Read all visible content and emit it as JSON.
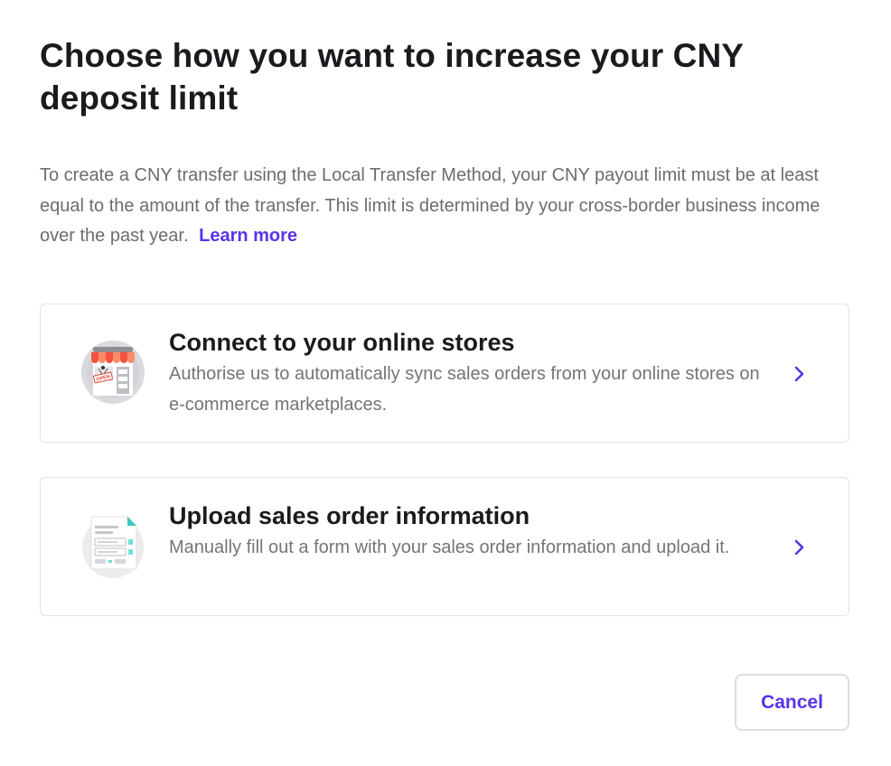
{
  "dialog": {
    "title": "Choose how you want to increase your CNY deposit limit",
    "description": "To create a CNY transfer using the Local Transfer Method, your CNY payout limit must be at least equal to the amount of the transfer. This limit is determined by your cross-border business income over the past year.",
    "learn_more": "Learn more"
  },
  "options": [
    {
      "title": "Connect to your online stores",
      "description": "Authorise us to automatically sync sales orders from your online stores on e-commerce marketplaces.",
      "icon": "storefront-icon",
      "icon_text": "OPEN"
    },
    {
      "title": "Upload sales order information",
      "description": "Manually fill out a form with your sales order information and upload it.",
      "icon": "document-form-icon"
    }
  ],
  "actions": {
    "cancel_label": "Cancel"
  },
  "colors": {
    "accent": "#5a33e6",
    "text_primary": "#1b1b1f",
    "text_secondary": "#6c6c72",
    "border": "#e3e3e8"
  }
}
